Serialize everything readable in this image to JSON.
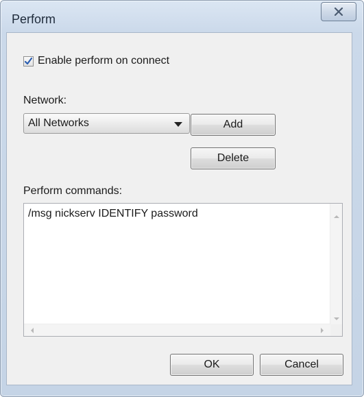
{
  "window": {
    "title": "Perform",
    "close_icon": "close-x-icon"
  },
  "enable": {
    "label": "Enable perform on connect",
    "checked": true
  },
  "network": {
    "label": "Network:",
    "selected": "All Networks",
    "add_label": "Add",
    "delete_label": "Delete"
  },
  "commands": {
    "label": "Perform commands:",
    "text": "/msg nickserv IDENTIFY password"
  },
  "footer": {
    "ok_label": "OK",
    "cancel_label": "Cancel"
  },
  "colors": {
    "title_bar": "#cbd9ea",
    "client_bg": "#f0f0f0",
    "checkmark": "#2a5db0"
  }
}
